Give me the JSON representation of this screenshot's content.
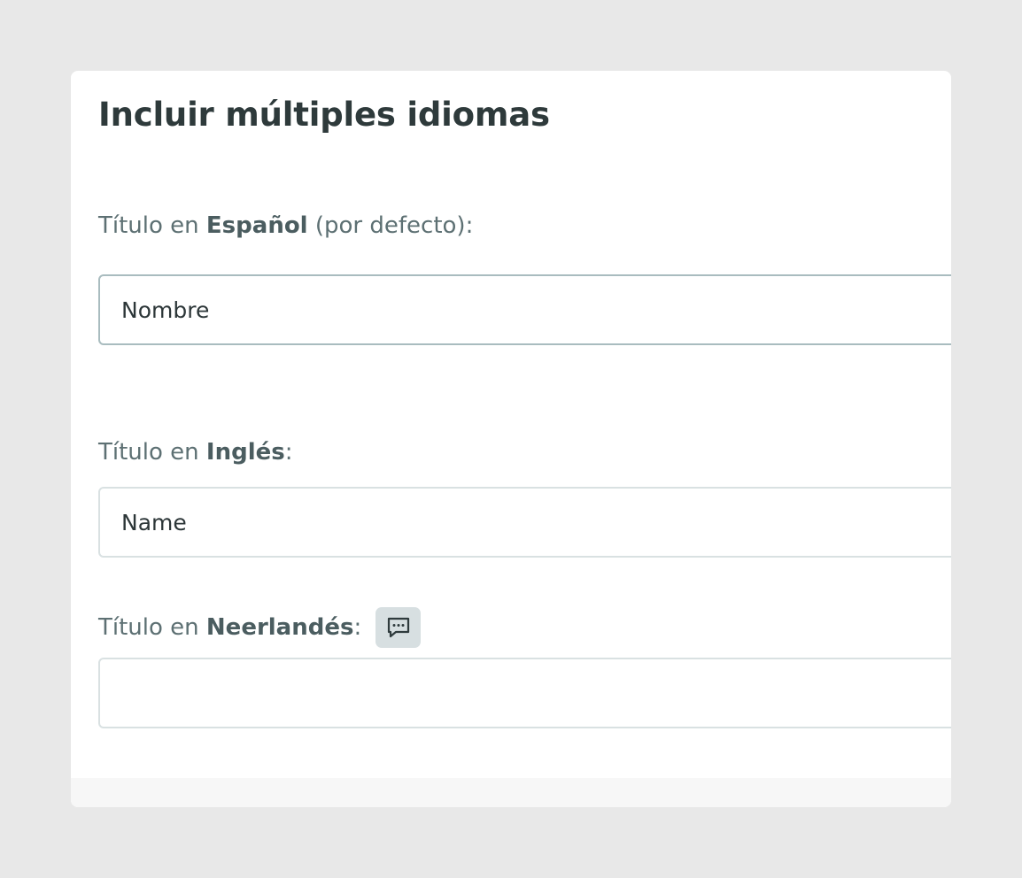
{
  "card": {
    "title": "Incluir múltiples idiomas"
  },
  "fields": {
    "spanish": {
      "label_prefix": "Título en ",
      "language": "Español",
      "label_suffix": " (por defecto):",
      "value": "Nombre"
    },
    "english": {
      "label_prefix": "Título en ",
      "language": "Inglés",
      "label_suffix": ":",
      "value": "Name"
    },
    "dutch": {
      "label_prefix": "Título en ",
      "language": "Neerlandés",
      "label_suffix": ":",
      "value": "",
      "comment_icon": "comment-dots-icon"
    }
  },
  "colors": {
    "background": "#e8e8e8",
    "card": "#ffffff",
    "title": "#2e3a3b",
    "label": "#5d7073",
    "input_border": "#d9e1e2",
    "input_border_active": "#a9bcbf",
    "icon_button": "#d7dfe1"
  }
}
